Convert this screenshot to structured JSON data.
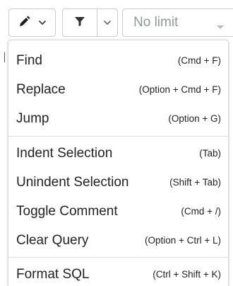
{
  "toolbar": {
    "edit_icon": "pencil-icon",
    "filter_icon": "filter-icon",
    "limit_value": "No limit"
  },
  "menu": {
    "groups": [
      {
        "items": [
          {
            "label": "Find",
            "shortcut": "(Cmd + F)"
          },
          {
            "label": "Replace",
            "shortcut": "(Option + Cmd + F)"
          },
          {
            "label": "Jump",
            "shortcut": "(Option + G)"
          }
        ]
      },
      {
        "items": [
          {
            "label": "Indent Selection",
            "shortcut": "(Tab)"
          },
          {
            "label": "Unindent Selection",
            "shortcut": "(Shift + Tab)"
          },
          {
            "label": "Toggle Comment",
            "shortcut": "(Cmd + /)"
          },
          {
            "label": "Clear Query",
            "shortcut": "(Option + Ctrl + L)"
          }
        ]
      },
      {
        "items": [
          {
            "label": "Format SQL",
            "shortcut": "(Ctrl + Shift + K)"
          }
        ]
      }
    ]
  },
  "colors": {
    "border": "#c9cdd2",
    "placeholder_text": "#8f959c",
    "icon": "#333333",
    "text": "#222222"
  }
}
